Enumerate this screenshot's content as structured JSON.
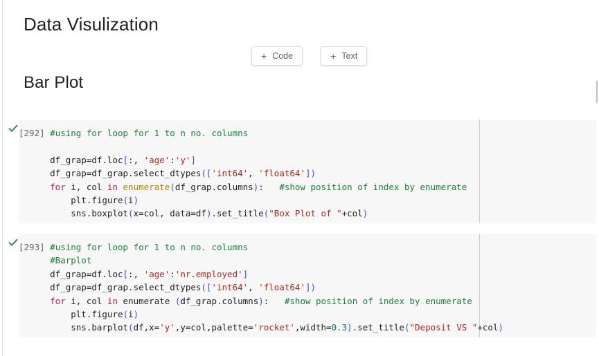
{
  "app": {
    "type": "colab-notebook"
  },
  "headings": {
    "title": "Data Visulization",
    "subtitle": "Bar Plot"
  },
  "toolbar": {
    "add_code_label": "Code",
    "add_text_label": "Text",
    "plus_glyph": "+",
    "code_icon": "plus-icon",
    "text_icon": "plus-icon"
  },
  "scrollbar": {
    "thumb_color": "#bdc1c6"
  },
  "colors": {
    "cell_background": "#f7f7f7",
    "comment": "#1a7f37",
    "string": "#b3261e",
    "keyword": "#c2185b",
    "builtin": "#b08000",
    "bracket": "#3c4cff",
    "number": "#0b7285",
    "check": "#1e8e3e",
    "text": "#202124"
  },
  "cells": [
    {
      "id": "cell-292",
      "status_icon": "check-icon",
      "prompt": "[292]",
      "first_line_comment": "#using for loop for 1 to n no. columns",
      "lines": [
        "",
        "df_grap=df.loc[:, 'age':'y']",
        "df_grap=df_grap.select_dtypes(['int64', 'float64'])",
        "for i, col in enumerate(df_grap.columns):   #show position of index by enumerate",
        "    plt.figure(i)",
        "    sns.boxplot(x=col, data=df).set_title(\"Box Plot of \"+col)"
      ]
    },
    {
      "id": "cell-293",
      "status_icon": "check-icon",
      "prompt": "[293]",
      "first_line_comment": "#using for loop for 1 to n no. columns",
      "lines": [
        "#Barplot",
        "df_grap=df.loc[:, 'age':'nr.employed']",
        "df_grap=df_grap.select_dtypes(['int64', 'float64'])",
        "for i, col in enumerate (df_grap.columns):   #show position of index by enumerate",
        "    plt.figure(i)",
        "    sns.barplot(df,x='y',y=col,palette='rocket',width=0.3).set_title(\"Deposit VS \"+col)"
      ]
    }
  ]
}
